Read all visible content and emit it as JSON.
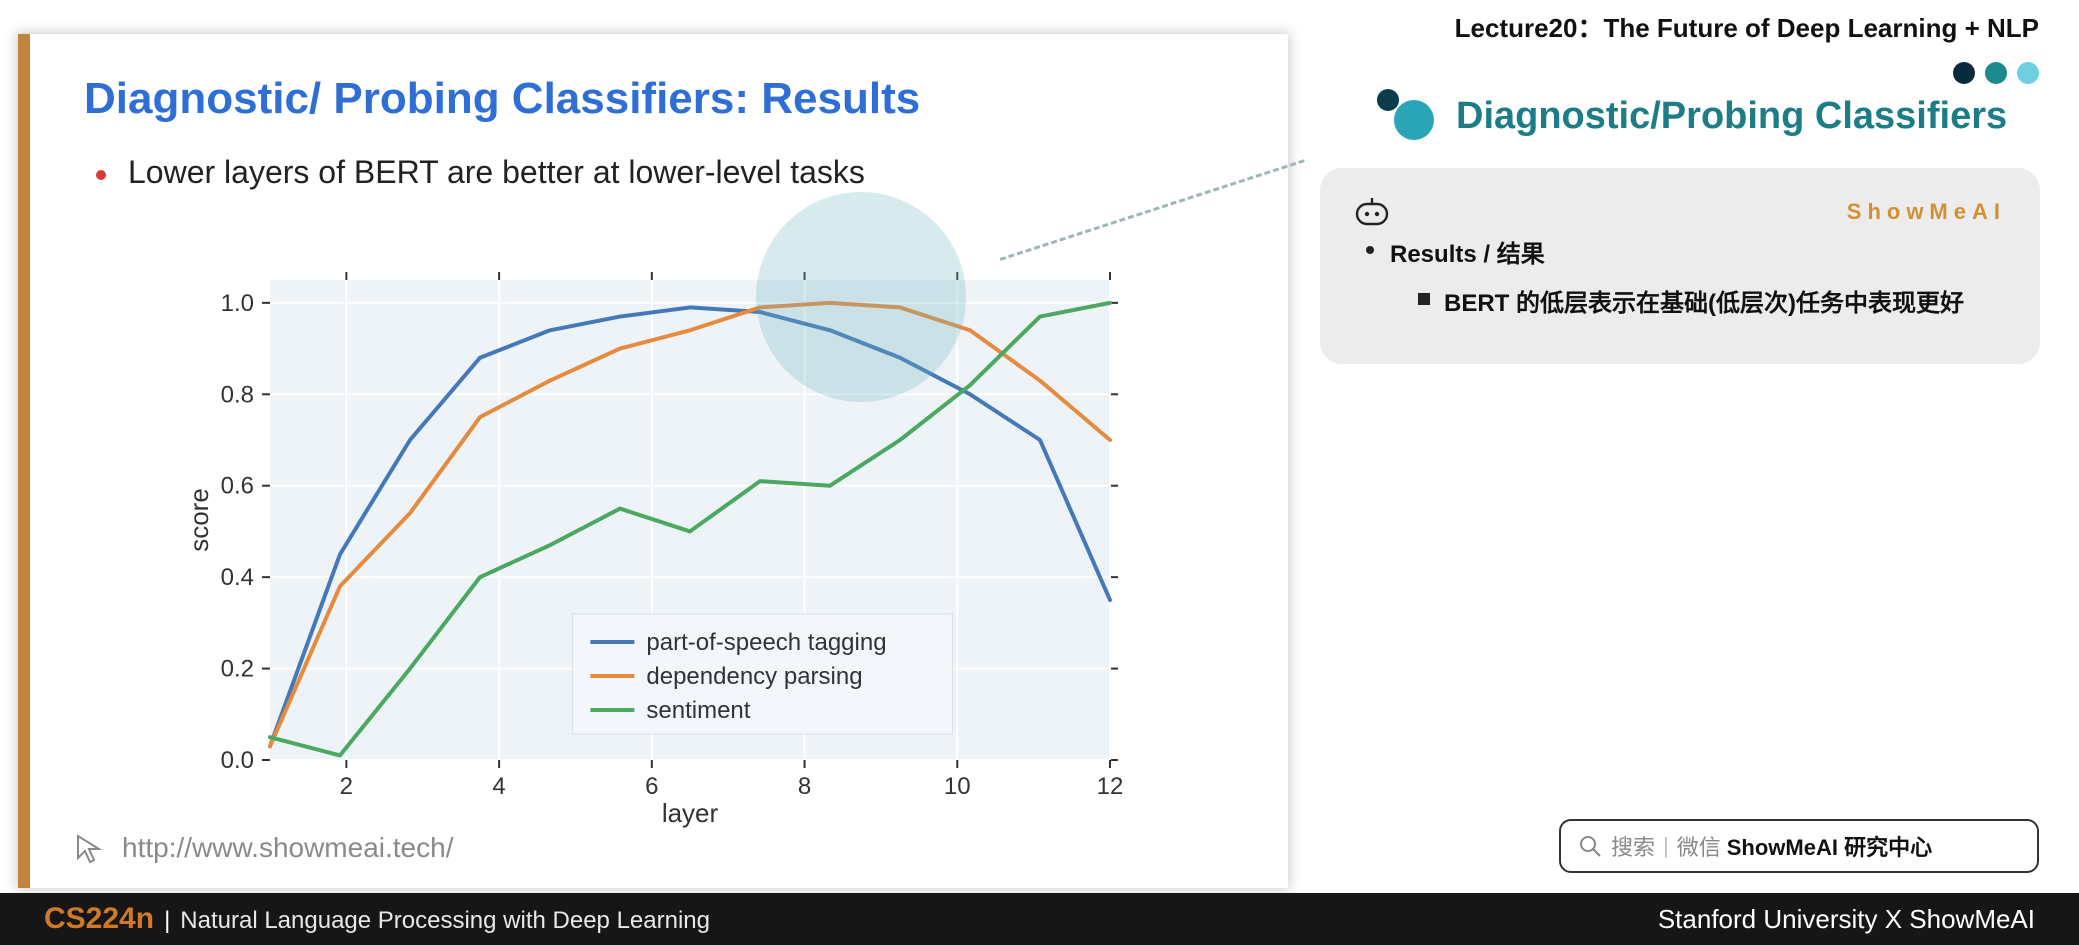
{
  "lecture_title": "Lecture20：The Future of Deep Learning + NLP",
  "section_title": "Diagnostic/Probing Classifiers",
  "slide": {
    "title": "Diagnostic/ Probing Classifiers: Results",
    "bullet": "Lower layers of BERT are better at lower-level tasks",
    "footer_url": "http://www.showmeai.tech/"
  },
  "note_card": {
    "brand": "ShowMeAI",
    "line1": "Results / 结果",
    "line2": "BERT 的低层表示在基础(低层次)任务中表现更好"
  },
  "search": {
    "hint1": "搜索",
    "hint2": "微信",
    "strong": "ShowMeAI 研究中心"
  },
  "footer": {
    "course": "CS224n",
    "subtitle": "Natural Language Processing with Deep Learning",
    "right": "Stanford University X ShowMeAI"
  },
  "chart_data": {
    "type": "line",
    "xlabel": "layer",
    "ylabel": "score",
    "xlim": [
      1,
      12
    ],
    "ylim": [
      0,
      1.05
    ],
    "xticks": [
      2,
      4,
      6,
      8,
      10,
      12
    ],
    "yticks": [
      0.0,
      0.2,
      0.4,
      0.6,
      0.8,
      1.0
    ],
    "legend_position": "lower-center",
    "x": [
      1,
      2,
      3,
      4,
      5,
      6,
      7,
      8,
      9,
      10,
      11,
      12
    ],
    "series": [
      {
        "name": "part-of-speech tagging",
        "color": "#4478b8",
        "values": [
          0.03,
          0.45,
          0.7,
          0.88,
          0.94,
          0.97,
          0.99,
          0.98,
          0.94,
          0.88,
          0.8,
          0.7,
          0.35
        ]
      },
      {
        "name": "dependency parsing",
        "color": "#e58b3e",
        "values": [
          0.03,
          0.38,
          0.54,
          0.75,
          0.83,
          0.9,
          0.94,
          0.99,
          1.0,
          0.99,
          0.94,
          0.83,
          0.7
        ]
      },
      {
        "name": "sentiment",
        "color": "#4aa860",
        "values": [
          0.05,
          0.01,
          0.2,
          0.4,
          0.47,
          0.55,
          0.5,
          0.61,
          0.6,
          0.7,
          0.82,
          0.97,
          1.0
        ]
      }
    ]
  }
}
